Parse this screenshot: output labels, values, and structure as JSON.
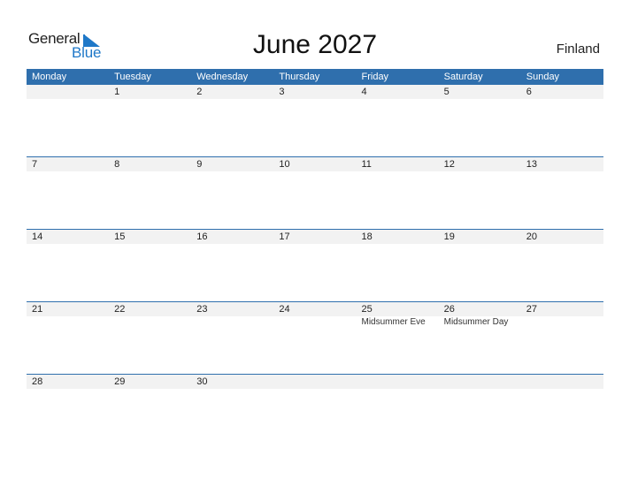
{
  "logo": {
    "line1": "General",
    "line2": "Blue"
  },
  "title": "June 2027",
  "country": "Finland",
  "colors": {
    "accent": "#2f6fad",
    "logo_blue": "#1f78c8",
    "date_bar": "#f2f2f2"
  },
  "weekdays": [
    "Monday",
    "Tuesday",
    "Wednesday",
    "Thursday",
    "Friday",
    "Saturday",
    "Sunday"
  ],
  "weeks": [
    [
      {
        "day": ""
      },
      {
        "day": "1"
      },
      {
        "day": "2"
      },
      {
        "day": "3"
      },
      {
        "day": "4"
      },
      {
        "day": "5"
      },
      {
        "day": "6"
      }
    ],
    [
      {
        "day": "7"
      },
      {
        "day": "8"
      },
      {
        "day": "9"
      },
      {
        "day": "10"
      },
      {
        "day": "11"
      },
      {
        "day": "12"
      },
      {
        "day": "13"
      }
    ],
    [
      {
        "day": "14"
      },
      {
        "day": "15"
      },
      {
        "day": "16"
      },
      {
        "day": "17"
      },
      {
        "day": "18"
      },
      {
        "day": "19"
      },
      {
        "day": "20"
      }
    ],
    [
      {
        "day": "21"
      },
      {
        "day": "22"
      },
      {
        "day": "23"
      },
      {
        "day": "24"
      },
      {
        "day": "25",
        "holiday": "Midsummer Eve"
      },
      {
        "day": "26",
        "holiday": "Midsummer Day"
      },
      {
        "day": "27"
      }
    ],
    [
      {
        "day": "28"
      },
      {
        "day": "29"
      },
      {
        "day": "30"
      },
      {
        "day": ""
      },
      {
        "day": ""
      },
      {
        "day": ""
      },
      {
        "day": ""
      }
    ]
  ]
}
